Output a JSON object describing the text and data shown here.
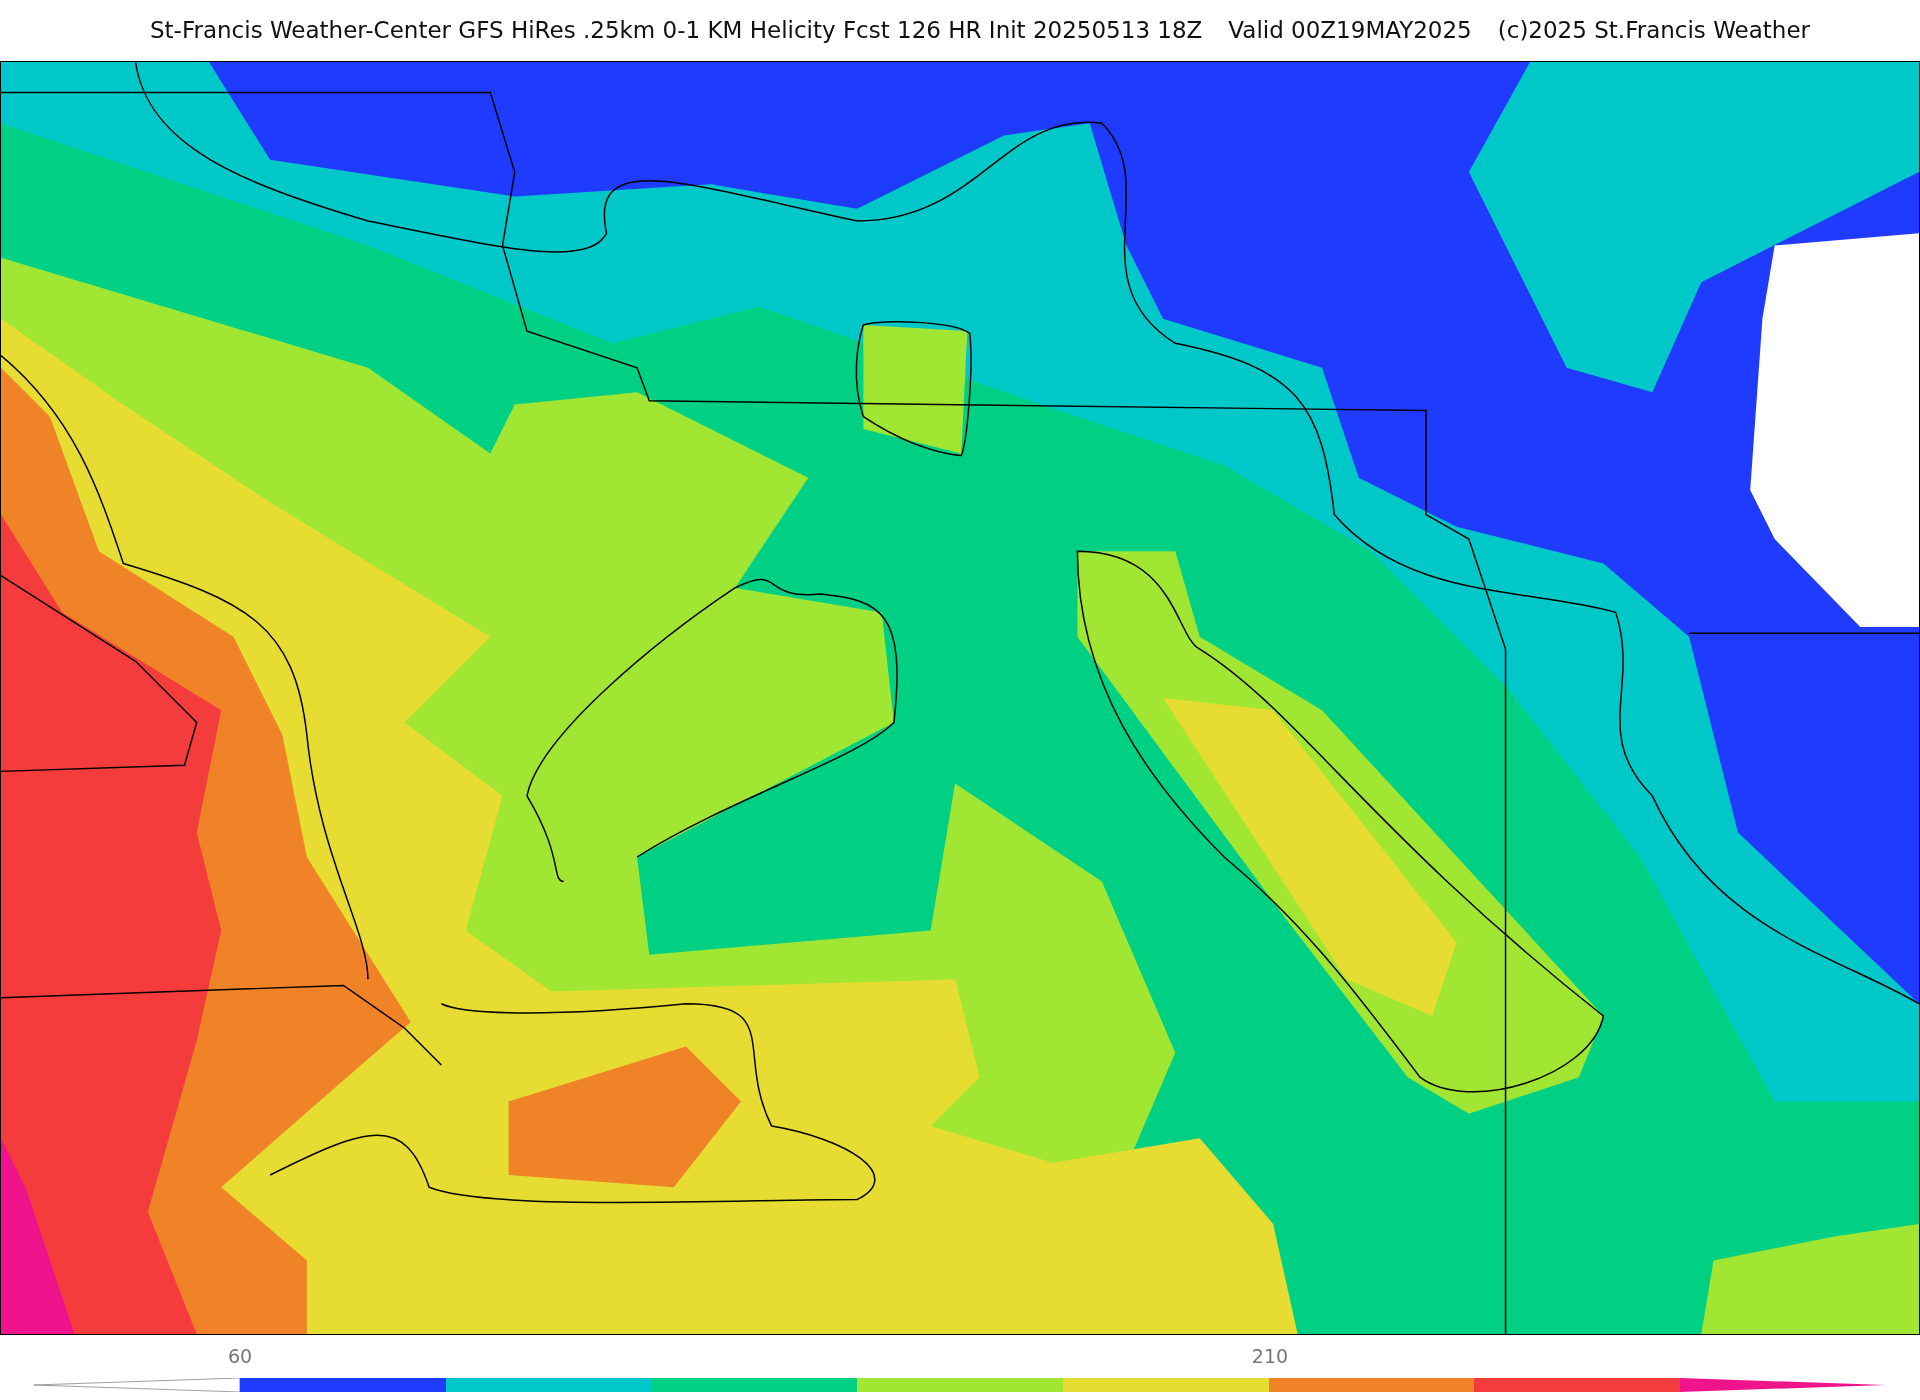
{
  "header": {
    "title": "St-Francis Weather-Center GFS HiRes .25km 0-1 KM Helicity Fcst 126 HR Init 20250513 18Z",
    "valid": "Valid 00Z19MAY2025",
    "copyright": "(c)2025 St.Francis Weather"
  },
  "colorbar": {
    "bins": [
      {
        "color": "#1f3bff",
        "label": "60"
      },
      {
        "color": "#00c8c8"
      },
      {
        "color": "#00d084"
      },
      {
        "color": "#a0e632"
      },
      {
        "color": "#e6dc32"
      },
      {
        "color": "#f08228",
        "label": "210"
      },
      {
        "color": "#f53c3c"
      }
    ]
  }
}
